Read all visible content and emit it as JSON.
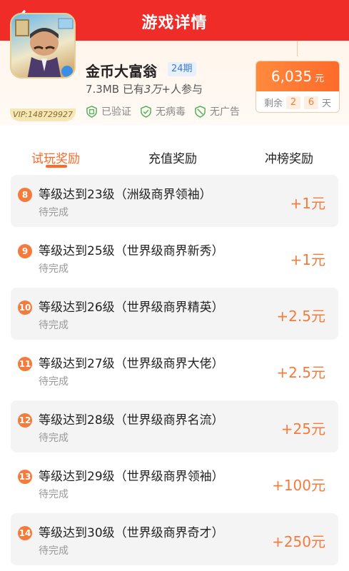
{
  "header": {
    "title": "游戏详情",
    "back_icon": "chevron-left-icon"
  },
  "game": {
    "name": "金币大富翁",
    "period": "24期",
    "size": "7.3MB",
    "participants_prefix": "已有",
    "participants_value": "3万+",
    "participants_suffix": "人参与",
    "vip_tag": "VIP:148729927",
    "badges": [
      {
        "label": "已验证",
        "icon": "verified-shield-icon"
      },
      {
        "label": "无病毒",
        "icon": "check-shield-icon"
      },
      {
        "label": "无广告",
        "icon": "slash-shield-icon"
      }
    ]
  },
  "reward_box": {
    "total": "6,035",
    "unit": "元",
    "remain_label": "剩余",
    "remain_digits": [
      "2",
      "6"
    ],
    "remain_unit": "天"
  },
  "tabs": [
    {
      "label": "试玩奖励",
      "active": true
    },
    {
      "label": "充值奖励",
      "active": false
    },
    {
      "label": "冲榜奖励",
      "active": false
    }
  ],
  "rewards": [
    {
      "num": "8",
      "task": "等级达到23级（洲级商界领袖）",
      "status": "待完成",
      "amount": "+1元"
    },
    {
      "num": "9",
      "task": "等级达到25级（世界级商界新秀）",
      "status": "待完成",
      "amount": "+1元"
    },
    {
      "num": "10",
      "task": "等级达到26级（世界级商界精英）",
      "status": "待完成",
      "amount": "+2.5元"
    },
    {
      "num": "11",
      "task": "等级达到27级（世界级商界大佬）",
      "status": "待完成",
      "amount": "+2.5元"
    },
    {
      "num": "12",
      "task": "等级达到28级（世界级商界名流）",
      "status": "待完成",
      "amount": "+25元"
    },
    {
      "num": "13",
      "task": "等级达到29级（世界级商界领袖）",
      "status": "待完成",
      "amount": "+100元"
    },
    {
      "num": "14",
      "task": "等级达到30级（世界级商界奇才）",
      "status": "待完成",
      "amount": "+250元"
    }
  ],
  "colors": {
    "header": "#ef2c28",
    "accent": "#ff6a2a",
    "badge_num": "#f47b3c"
  }
}
